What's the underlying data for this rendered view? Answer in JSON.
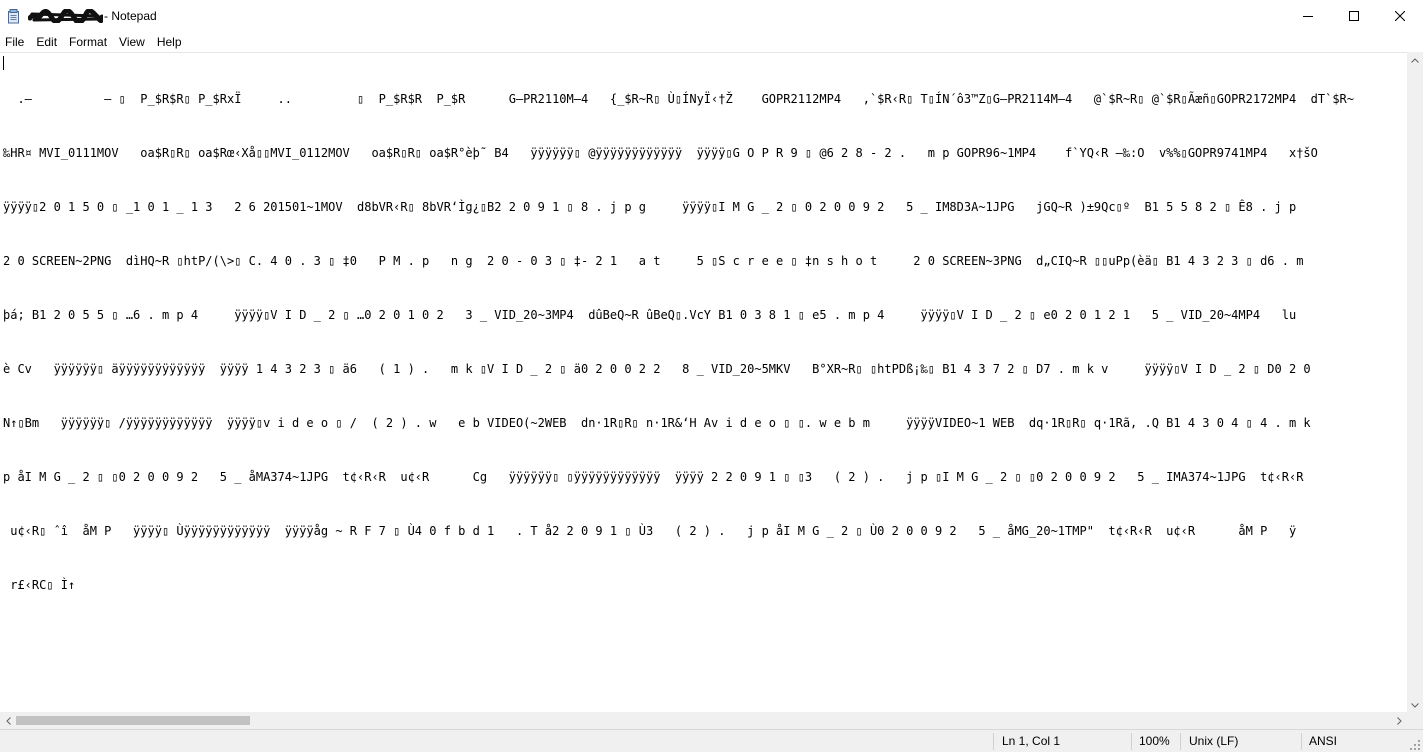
{
  "window": {
    "title": "- Notepad",
    "owner_name_redacted": true
  },
  "menu": {
    "items": [
      "File",
      "Edit",
      "Format",
      "View",
      "Help"
    ]
  },
  "editor": {
    "lines": [
      "  .–          – ▯  P_$R$R▯ P_$RxÏ     ..         ▯  P_$R$R  P_$R      G—PR2110M—4   {_$R~R▯ Ù▯ÍNyÏ‹†Ž    GOPR2112MP4   ,`$R‹R▯ T▯ÍN´ô3™Z▯G—PR2114M—4   @`$R~R▯ @`$R▯Ãæñ▯GOPR2172MP4  dT`$R~",
      "‰HR¤ MVI_0111MOV   oa$R▯R▯ oa$Rœ‹Xå▯▯MVI_0112MOV   oa$R▯R▯ oa$R°èþ˜ B4   ÿÿÿÿÿÿ▯ @ÿÿÿÿÿÿÿÿÿÿÿÿ  ÿÿÿÿ▯G O P R 9 ▯ @6 2 8 - 2 .   m p GOPR96~1MP4    f`YQ‹R —‰:O  v%%▯GOPR9741MP4   x†šO",
      "ÿÿÿÿ▯2 0 1 5 0 ▯ _1 0 1 _ 1 3   2 6 201501~1MOV  d8bVR‹R▯ 8bVR‘Ìg¿▯B2 2 0 9 1 ▯ 8 . j p g     ÿÿÿÿ▯I M G _ 2 ▯ 0 2 0 0 9 2   5 _ IM8D3A~1JPG   jGQ~R )±9Qc▯º  B1 5 5 8 2 ▯ Ê8 . j p",
      "2 0 SCREEN~2PNG  dìHQ~R ▯htP/(\\>▯ C. 4 0 . 3 ▯ ‡0   P M . p   n g  2 0 - 0 3 ▯ ‡- 2 1   a t     5 ▯S c r e e ▯ ‡n s h o t     2 0 SCREEN~3PNG  d„CIQ~R ▯▯uPp(èä▯ B1 4 3 2 3 ▯ d6 . m",
      "þá; B1 2 0 5 5 ▯ …6 . m p 4     ÿÿÿÿ▯V I D _ 2 ▯ …0 2 0 1 0 2   3 _ VID_20~3MP4  dûBeQ~R ûBeQ▯.VcY B1 0 3 8 1 ▯ e5 . m p 4     ÿÿÿÿ▯V I D _ 2 ▯ e0 2 0 1 2 1   5 _ VID_20~4MP4   lu",
      "è Cv   ÿÿÿÿÿÿ▯ äÿÿÿÿÿÿÿÿÿÿÿÿ  ÿÿÿÿ 1 4 3 2 3 ▯ ä6   ( 1 ) .   m k ▯V I D _ 2 ▯ ä0 2 0 0 2 2   8 _ VID_20~5MKV   B°XR~R▯ ▯htPDß¡‰▯ B1 4 3 7 2 ▯ D7 . m k v     ÿÿÿÿ▯V I D _ 2 ▯ D0 2 0",
      "N↑▯Bm   ÿÿÿÿÿÿ▯ /ÿÿÿÿÿÿÿÿÿÿÿÿ  ÿÿÿÿ▯v i d e o ▯ /  ( 2 ) . w   e b VIDEO(~2WEB  dn·1R▯R▯ n·1R&‘H Av i d e o ▯ ▯. w e b m     ÿÿÿÿVIDEO~1 WEB  dq·1R▯R▯ q·1Rã, .Q B1 4 3 0 4 ▯ 4 . m k",
      "p åI M G _ 2 ▯ ▯0 2 0 0 9 2   5 _ åMA374~1JPG  t¢‹R‹R  u¢‹R      Cg   ÿÿÿÿÿÿ▯ ▯ÿÿÿÿÿÿÿÿÿÿÿÿ  ÿÿÿÿ 2 2 0 9 1 ▯ ▯3   ( 2 ) .   j p ▯I M G _ 2 ▯ ▯0 2 0 0 9 2   5 _ IMA374~1JPG  t¢‹R‹R",
      " u¢‹R▯ ˆî  åM P   ÿÿÿÿ▯ Ùÿÿÿÿÿÿÿÿÿÿÿÿ  ÿÿÿÿåg ~ R F 7 ▯ Ù4 0 f b d 1   . T å2 2 0 9 1 ▯ Ù3   ( 2 ) .   j p åI M G _ 2 ▯ Ù0 2 0 0 9 2   5 _ åMG_20~1TMP\"  t¢‹R‹R  u¢‹R      åM P   ÿ",
      " r£‹RC▯ Ì↑"
    ]
  },
  "statusbar": {
    "position": "Ln 1, Col 1",
    "zoom": "100%",
    "line_endings": "Unix (LF)",
    "encoding": "ANSI"
  },
  "icons": {
    "app": "notepad-icon",
    "minimize": "minimize-icon",
    "maximize": "maximize-icon",
    "close": "close-icon"
  }
}
